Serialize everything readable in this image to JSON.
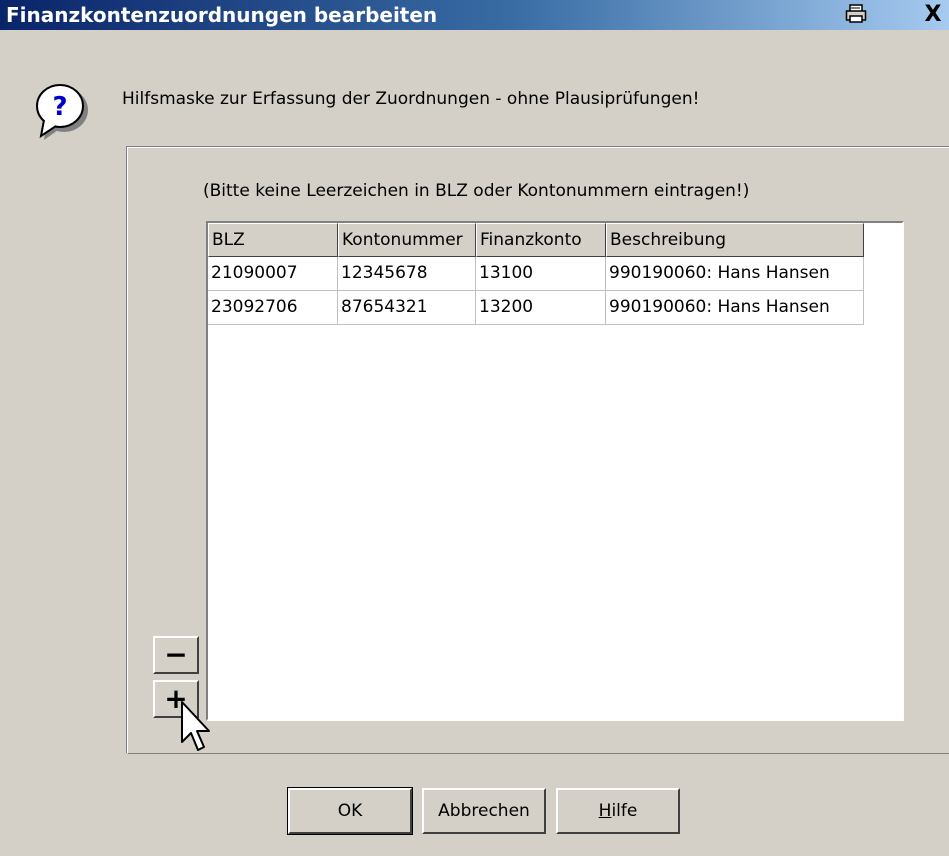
{
  "window": {
    "title": "Finanzkontenzuordnungen bearbeiten",
    "close_glyph": "X"
  },
  "hint": "Hilfsmaske zur Erfassung der Zuordnungen - ohne Plausiprüfungen!",
  "note": "(Bitte keine Leerzeichen in BLZ oder Kontonummern eintragen!)",
  "table": {
    "columns": [
      "BLZ",
      "Kontonummer",
      "Finanzkonto",
      "Beschreibung"
    ],
    "rows": [
      [
        "21090007",
        "12345678",
        "13100",
        "990190060: Hans Hansen"
      ],
      [
        "23092706",
        "87654321",
        "13200",
        "990190060: Hans Hansen"
      ]
    ]
  },
  "side_buttons": {
    "remove": "−",
    "add": "+"
  },
  "buttons": {
    "ok": "OK",
    "cancel": "Abbrechen",
    "help_mnemonic": "H",
    "help_rest": "ilfe"
  },
  "icons": [
    "print-icon",
    "close-icon",
    "question-icon",
    "mouse-cursor-icon"
  ]
}
